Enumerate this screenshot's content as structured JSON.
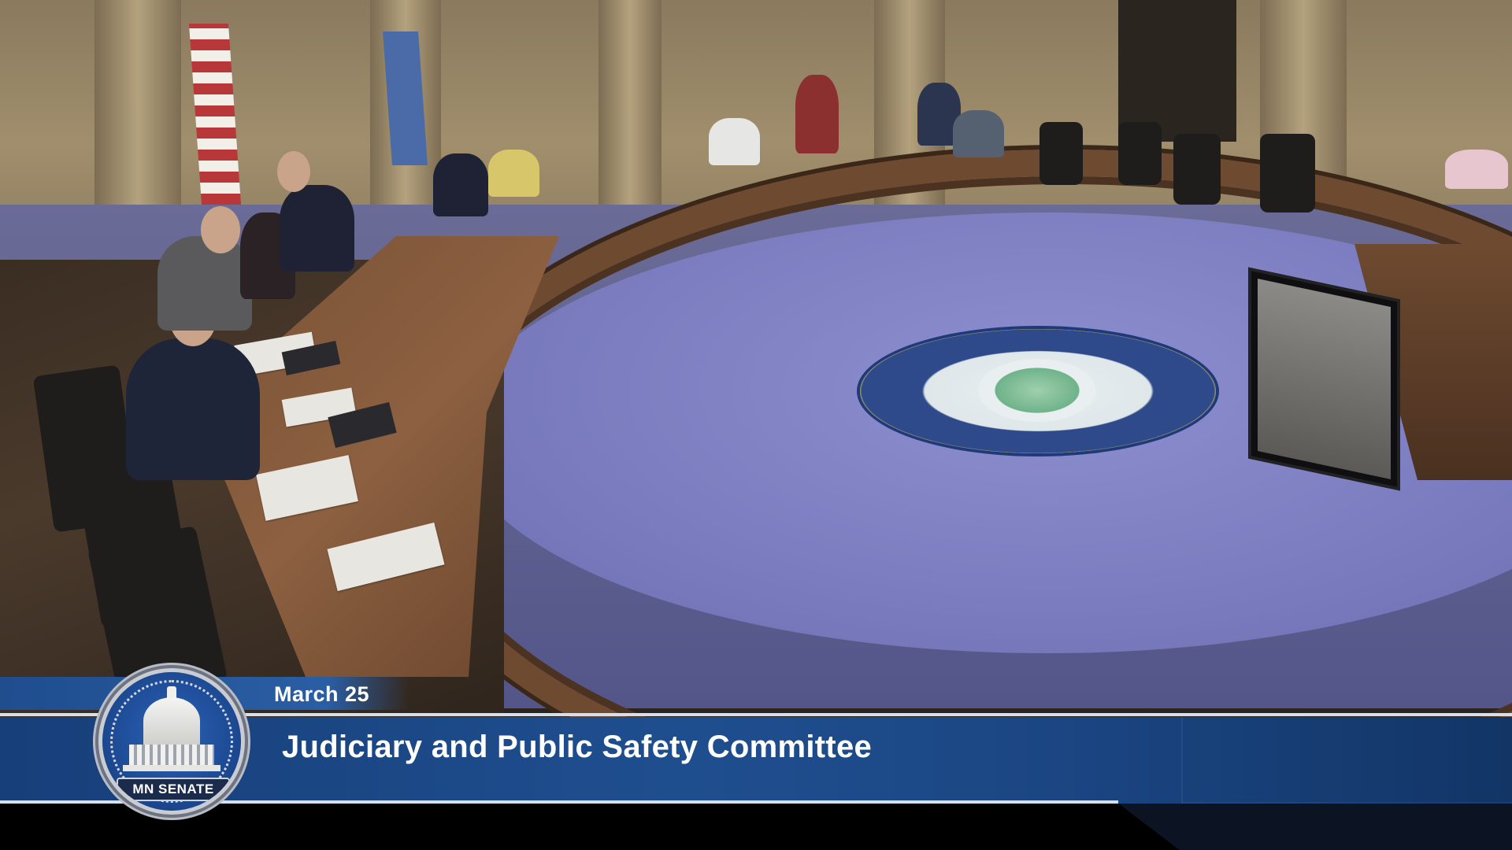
{
  "broadcast": {
    "date": "March 25",
    "title": "Judiciary and Public Safety Committee",
    "logo_label": "MN SENATE"
  },
  "colors": {
    "banner_blue": "#1f4e8f",
    "date_bar_blue": "#2a5ea4",
    "divider": "#d9dfe8",
    "text": "#ffffff"
  },
  "icons": {
    "logo": "capitol-dome-badge-icon",
    "seal": "state-seal-icon"
  }
}
